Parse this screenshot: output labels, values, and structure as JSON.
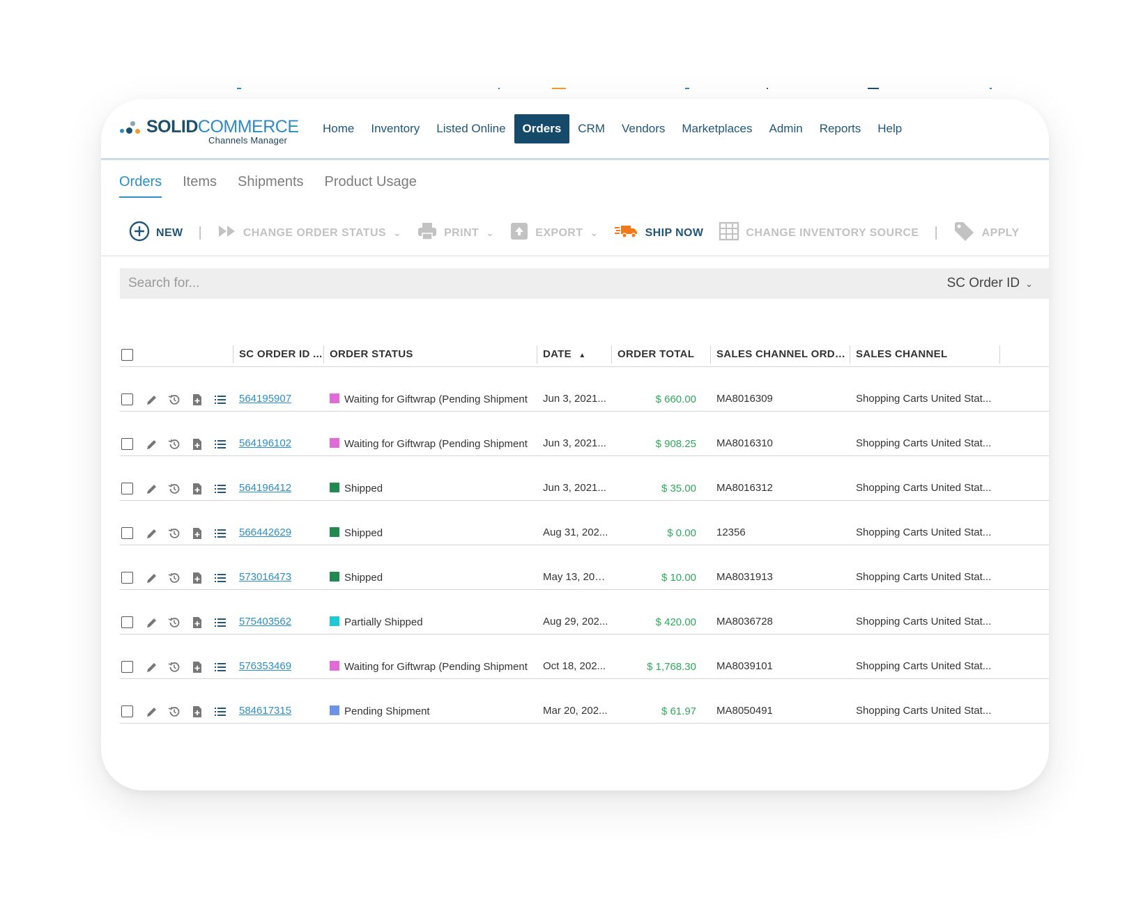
{
  "brand": {
    "name_bold": "SOLID",
    "name_light": "COMMERCE",
    "subtitle": "Channels Manager",
    "dot_colors": [
      "#2d8bc2",
      "#1b4f6c",
      "#f29a2e"
    ]
  },
  "nav": {
    "items": [
      "Home",
      "Inventory",
      "Listed Online",
      "Orders",
      "CRM",
      "Vendors",
      "Marketplaces",
      "Admin",
      "Reports",
      "Help"
    ],
    "active": "Orders"
  },
  "subtabs": {
    "items": [
      "Orders",
      "Items",
      "Shipments",
      "Product Usage"
    ],
    "active": "Orders"
  },
  "toolbar": {
    "new_label": "NEW",
    "change_status_label": "CHANGE ORDER STATUS",
    "print_label": "PRINT",
    "export_label": "EXPORT",
    "ship_now_label": "SHIP NOW",
    "change_inventory_label": "CHANGE INVENTORY SOURCE",
    "apply_label": "APPLY"
  },
  "search": {
    "placeholder": "Search for...",
    "field": "SC Order ID"
  },
  "grid": {
    "columns": [
      "SC ORDER ID ...",
      "ORDER STATUS",
      "DATE",
      "ORDER TOTAL",
      "SALES CHANNEL ORDER...",
      "SALES CHANNEL"
    ],
    "sort_indicator": "▲",
    "rows": [
      {
        "id": "564195907",
        "status": "Waiting for Giftwrap (Pending Shipment",
        "status_color": "#e26ad6",
        "date": "Jun 3, 2021...",
        "total": "$ 660.00",
        "channel_order": "MA8016309",
        "channel": "Shopping Carts United Stat..."
      },
      {
        "id": "564196102",
        "status": "Waiting for Giftwrap (Pending Shipment",
        "status_color": "#e26ad6",
        "date": "Jun 3, 2021...",
        "total": "$ 908.25",
        "channel_order": "MA8016310",
        "channel": "Shopping Carts United Stat..."
      },
      {
        "id": "564196412",
        "status": "Shipped",
        "status_color": "#238a4f",
        "date": "Jun 3, 2021...",
        "total": "$ 35.00",
        "channel_order": "MA8016312",
        "channel": "Shopping Carts United Stat..."
      },
      {
        "id": "566442629",
        "status": "Shipped",
        "status_color": "#238a4f",
        "date": "Aug 31, 202...",
        "total": "$ 0.00",
        "channel_order": "12356",
        "channel": "Shopping Carts United Stat..."
      },
      {
        "id": "573016473",
        "status": "Shipped",
        "status_color": "#238a4f",
        "date": "May 13, 202...",
        "total": "$ 10.00",
        "channel_order": "MA8031913",
        "channel": "Shopping Carts United Stat..."
      },
      {
        "id": "575403562",
        "status": "Partially Shipped",
        "status_color": "#1ccad6",
        "date": "Aug 29, 202...",
        "total": "$ 420.00",
        "channel_order": "MA8036728",
        "channel": "Shopping Carts United Stat..."
      },
      {
        "id": "576353469",
        "status": "Waiting for Giftwrap (Pending Shipment",
        "status_color": "#e26ad6",
        "date": "Oct 18, 202...",
        "total": "$ 1,768.30",
        "channel_order": "MA8039101",
        "channel": "Shopping Carts United Stat..."
      },
      {
        "id": "584617315",
        "status": "Pending Shipment",
        "status_color": "#6b93ea",
        "date": "Mar 20, 202...",
        "total": "$ 61.97",
        "channel_order": "MA8050491",
        "channel": "Shopping Carts United Stat..."
      }
    ]
  },
  "colors": {
    "nav_active_bg": "#164a6b",
    "link": "#2b8ec4",
    "money": "#2fa85a",
    "ship_now_icon": "#f07a1a"
  }
}
